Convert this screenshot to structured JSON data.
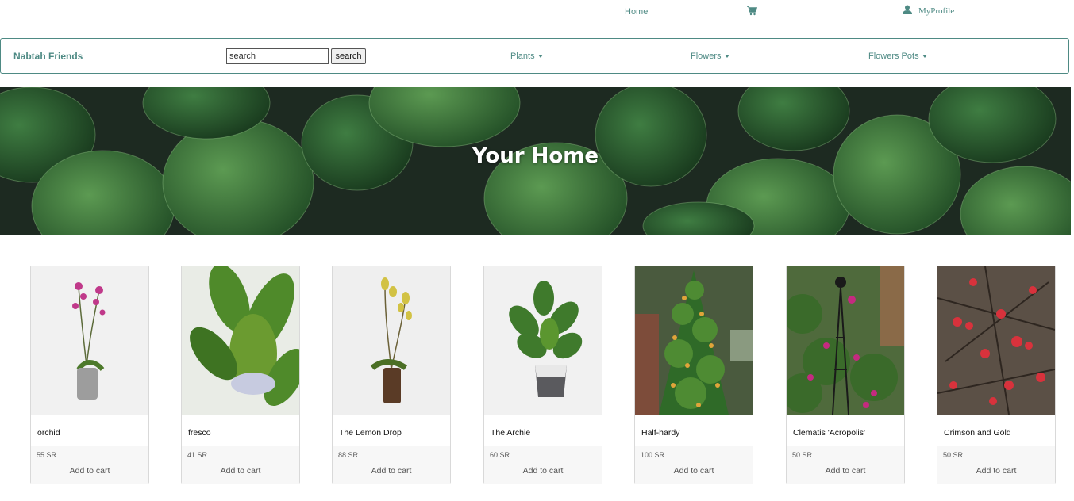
{
  "topnav": {
    "home_label": "Home",
    "cart_icon": "cart-icon",
    "profile_icon": "user-icon",
    "profile_label": "MyProfile"
  },
  "navbar": {
    "brand": "Nabtah Friends",
    "search_placeholder": "search",
    "search_button": "search",
    "menus": [
      "Plants",
      "Flowers",
      "Flowers Pots"
    ]
  },
  "hero": {
    "title": "Your Home"
  },
  "products": [
    {
      "name": "orchid",
      "price": "55 SR",
      "cta": "Add to cart"
    },
    {
      "name": "fresco",
      "price": "41 SR",
      "cta": "Add to cart"
    },
    {
      "name": "The Lemon Drop",
      "price": "88 SR",
      "cta": "Add to cart"
    },
    {
      "name": "The Archie",
      "price": "60 SR",
      "cta": "Add to cart"
    },
    {
      "name": "Half-hardy",
      "price": "100 SR",
      "cta": "Add to cart"
    },
    {
      "name": "Clematis 'Acropolis'",
      "price": "50 SR",
      "cta": "Add to cart"
    },
    {
      "name": "Crimson and Gold",
      "price": "50 SR",
      "cta": "Add to cart"
    }
  ],
  "colors": {
    "accent": "#4e8a84",
    "hero_bg": "#1e2a22"
  }
}
